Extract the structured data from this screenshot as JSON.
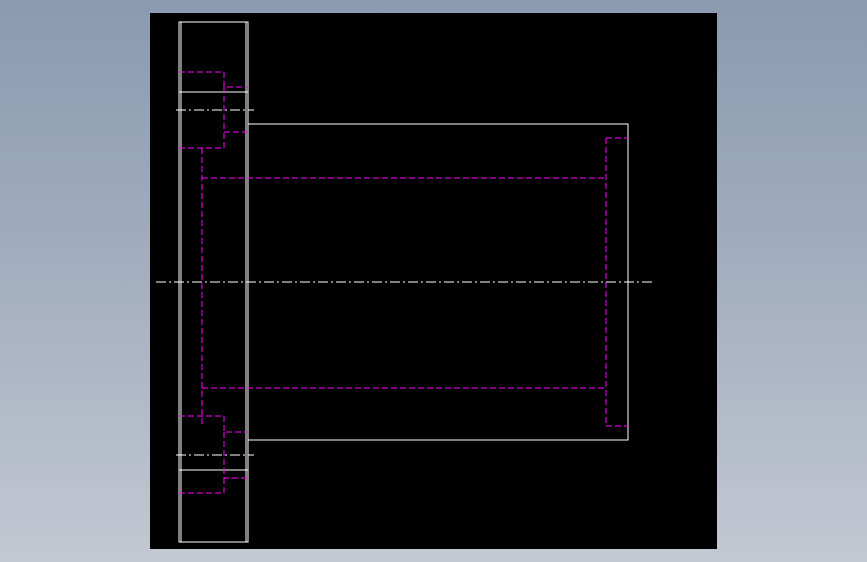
{
  "colors": {
    "background": "#000000",
    "outline": "#ffffff",
    "hidden_line": "#ff00ff",
    "centerline": "#ffffff"
  }
}
